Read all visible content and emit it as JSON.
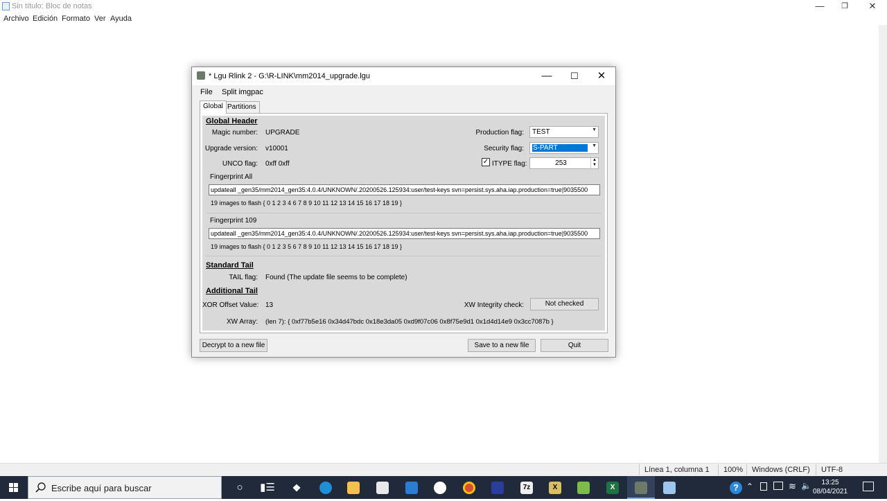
{
  "notepad": {
    "title": "Sin título: Bloc de notas",
    "menu": [
      "Archivo",
      "Edición",
      "Formato",
      "Ver",
      "Ayuda"
    ],
    "status": {
      "position": "Línea 1, columna 1",
      "zoom": "100%",
      "line_endings": "Windows (CRLF)",
      "encoding": "UTF-8"
    }
  },
  "lgu": {
    "title": "* Lgu Rlink 2 - G:\\R-LINK\\mm2014_upgrade.lgu",
    "menu": [
      "File",
      "Split imgpac"
    ],
    "tabs": [
      "Global",
      "Partitions"
    ],
    "global_header": {
      "title": "Global Header",
      "magic_label": "Magic number:",
      "magic_value": "UPGRADE",
      "upgrade_version_label": "Upgrade version:",
      "upgrade_version_value": "v10001",
      "unco_label": "UNCO flag:",
      "unco_value": "0xff 0xff",
      "production_label": "Production flag:",
      "production_value": "TEST",
      "security_label": "Security flag:",
      "security_value": "S-PART",
      "itype_label": "ITYPE flag:",
      "itype_value": "253",
      "itype_checked": true
    },
    "fingerprint_all": {
      "label": "Fingerprint All",
      "value": "updateall _gen35/mm2014_gen35:4.0.4/UNKNOWN/.20200526.125934:user/test-keys svn=persist.sys.aha.iap.production=true|9035500",
      "images": "19 images to flash { 0 1 2 3 4 6 7 8 9 10 11 12 13 14 15 16 17 18 19 }"
    },
    "fingerprint_109": {
      "label": "Fingerprint 109",
      "value": "updateall _gen35/mm2014_gen35:4.0.4/UNKNOWN/.20200526.125934:user/test-keys svn=persist.sys.aha.iap.production=true|9035500",
      "images": "19 images to flash { 0 1 2 3 5 6 7 8 9 10 11 12 13 14 15 16 17 18 19 }"
    },
    "standard_tail": {
      "title": "Standard Tail",
      "tail_label": "TAIL flag:",
      "tail_value": "Found (The update file seems to be complete)"
    },
    "additional_tail": {
      "title": "Additional Tail",
      "xor_label": "XOR Offset Value:",
      "xor_value": "13",
      "xw_check_label": "XW Integrity check:",
      "xw_check_button": "Not checked",
      "xw_array_label": "XW Array:",
      "xw_array_value": "(len 7): { 0xf77b5e16 0x34d47bdc 0x18e3da05 0xd9f07c06 0x8f75e9d1 0x1d4d14e9 0x3cc7087b }"
    },
    "buttons": {
      "decrypt": "Decrypt to a new file",
      "save": "Save to a new file",
      "quit": "Quit"
    }
  },
  "taskbar": {
    "search_placeholder": "Escribe aquí para buscar",
    "time": "13:25",
    "date": "08/04/2021"
  },
  "colors": {
    "taskbar": "#202a3a",
    "selection": "#0078d7",
    "dialog_bg": "#f0f0f0",
    "panel_bg": "#d9d9d9"
  }
}
